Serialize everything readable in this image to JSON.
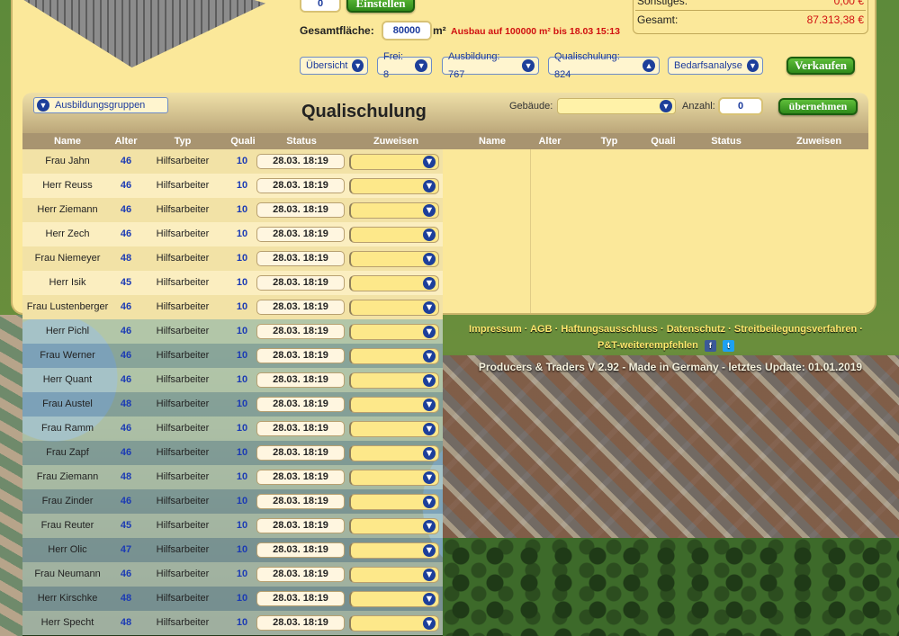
{
  "top": {
    "amount_value": "0",
    "einstellen_label": "Einstellen",
    "gesamtflaeche_label": "Gesamtfläche:",
    "gesamtflaeche_value": "80000",
    "unit": "m²",
    "warning": "Ausbau auf 100000 m² bis 18.03 15:13",
    "summary": [
      {
        "label": "Sonstiges:",
        "value": "0,00 €"
      },
      {
        "label": "Gesamt:",
        "value": "87.313,38 €"
      }
    ],
    "pills": [
      {
        "label": "Übersicht"
      },
      {
        "label": "Frei: 8"
      },
      {
        "label": "Ausbildung: 767"
      },
      {
        "label": "Qualischulung: 824"
      },
      {
        "label": "Bedarfsanalyse"
      }
    ],
    "verkaufen_label": "Verkaufen"
  },
  "panel": {
    "group_button": "Ausbildungsgruppen",
    "title": "Qualischulung",
    "gebaeude_label": "Gebäude:",
    "anzahl_label": "Anzahl:",
    "anzahl_value": "0",
    "uebernehmen_label": "übernehmen",
    "left_columns": [
      "Name",
      "Alter",
      "Typ",
      "Quali",
      "Status",
      "Zuweisen"
    ],
    "right_columns": [
      "Name",
      "Alter",
      "Typ",
      "Quali",
      "Status",
      "Zuweisen"
    ]
  },
  "rows": [
    {
      "name": "Frau Jahn",
      "age": "46",
      "type": "Hilfsarbeiter",
      "quali": "10",
      "status": "28.03. 18:19"
    },
    {
      "name": "Herr Reuss",
      "age": "46",
      "type": "Hilfsarbeiter",
      "quali": "10",
      "status": "28.03. 18:19"
    },
    {
      "name": "Herr Ziemann",
      "age": "46",
      "type": "Hilfsarbeiter",
      "quali": "10",
      "status": "28.03. 18:19"
    },
    {
      "name": "Herr Zech",
      "age": "46",
      "type": "Hilfsarbeiter",
      "quali": "10",
      "status": "28.03. 18:19"
    },
    {
      "name": "Frau Niemeyer",
      "age": "48",
      "type": "Hilfsarbeiter",
      "quali": "10",
      "status": "28.03. 18:19"
    },
    {
      "name": "Herr Isik",
      "age": "45",
      "type": "Hilfsarbeiter",
      "quali": "10",
      "status": "28.03. 18:19"
    },
    {
      "name": "Frau Lustenberger",
      "age": "46",
      "type": "Hilfsarbeiter",
      "quali": "10",
      "status": "28.03. 18:19"
    },
    {
      "name": "Herr Pichl",
      "age": "46",
      "type": "Hilfsarbeiter",
      "quali": "10",
      "status": "28.03. 18:19"
    },
    {
      "name": "Frau Werner",
      "age": "46",
      "type": "Hilfsarbeiter",
      "quali": "10",
      "status": "28.03. 18:19"
    },
    {
      "name": "Herr Quant",
      "age": "46",
      "type": "Hilfsarbeiter",
      "quali": "10",
      "status": "28.03. 18:19"
    },
    {
      "name": "Frau Austel",
      "age": "48",
      "type": "Hilfsarbeiter",
      "quali": "10",
      "status": "28.03. 18:19"
    },
    {
      "name": "Frau Ramm",
      "age": "46",
      "type": "Hilfsarbeiter",
      "quali": "10",
      "status": "28.03. 18:19"
    },
    {
      "name": "Frau Zapf",
      "age": "46",
      "type": "Hilfsarbeiter",
      "quali": "10",
      "status": "28.03. 18:19"
    },
    {
      "name": "Frau Ziemann",
      "age": "48",
      "type": "Hilfsarbeiter",
      "quali": "10",
      "status": "28.03. 18:19"
    },
    {
      "name": "Frau Zinder",
      "age": "46",
      "type": "Hilfsarbeiter",
      "quali": "10",
      "status": "28.03. 18:19"
    },
    {
      "name": "Frau Reuter",
      "age": "45",
      "type": "Hilfsarbeiter",
      "quali": "10",
      "status": "28.03. 18:19"
    },
    {
      "name": "Herr Olic",
      "age": "47",
      "type": "Hilfsarbeiter",
      "quali": "10",
      "status": "28.03. 18:19"
    },
    {
      "name": "Frau Neumann",
      "age": "46",
      "type": "Hilfsarbeiter",
      "quali": "10",
      "status": "28.03. 18:19"
    },
    {
      "name": "Herr Kirschke",
      "age": "48",
      "type": "Hilfsarbeiter",
      "quali": "10",
      "status": "28.03. 18:19"
    },
    {
      "name": "Herr Specht",
      "age": "48",
      "type": "Hilfsarbeiter",
      "quali": "10",
      "status": "28.03. 18:19"
    }
  ],
  "footer": {
    "links": [
      "Impressum",
      "AGB",
      "Haftungsausschluss",
      "Datenschutz",
      "Streitbeilegungsverfahren",
      "P&T-weiterempfehlen"
    ],
    "version": "Producers & Traders V 2.92 - Made in Germany - letztes Update: 01.01.2019"
  },
  "icons": {
    "dropdown": "chevron-down-circle-icon",
    "facebook": "facebook-icon",
    "twitter": "twitter-icon"
  },
  "colors": {
    "panel": "#fbe89a",
    "accent_blue": "#1b3a9c",
    "warning_red": "#d01010",
    "button_green": "#2f8a1a"
  }
}
